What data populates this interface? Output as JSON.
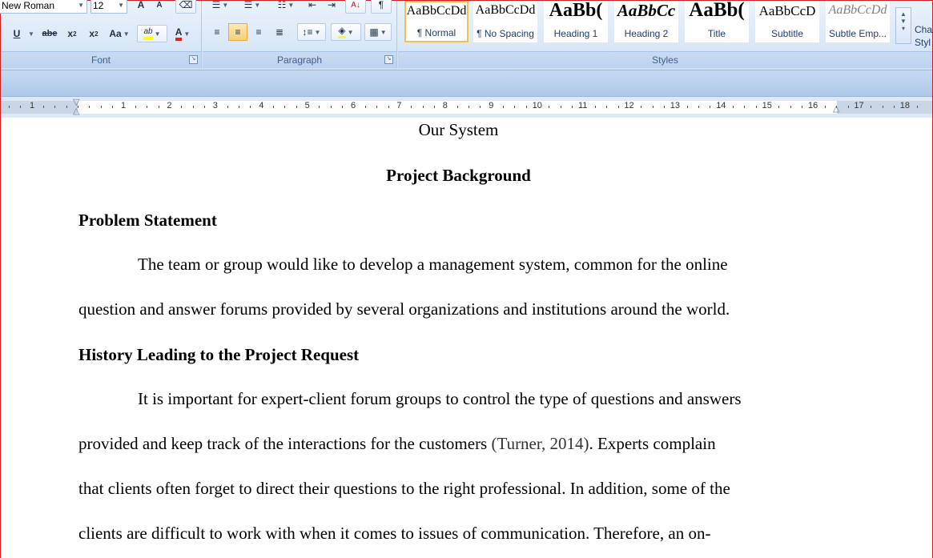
{
  "ribbon": {
    "font": {
      "name_value": "New Roman",
      "size_value": "12",
      "grow_label": "A",
      "shrink_label": "A",
      "underline_label": "U",
      "strike_label": "abe",
      "subscript_label": "x",
      "superscript_label": "x",
      "change_case_label": "Aa",
      "highlight_label": "ab",
      "font_color_label": "A",
      "group_label": "Font"
    },
    "paragraph": {
      "group_label": "Paragraph"
    },
    "styles": {
      "group_label": "Styles",
      "tiles": [
        {
          "sample": "AaBbCcDd",
          "name": "¶ Normal"
        },
        {
          "sample": "AaBbCcDd",
          "name": "¶ No Spacing"
        },
        {
          "sample": "AaBb(",
          "name": "Heading 1"
        },
        {
          "sample": "AaBbCc",
          "name": "Heading 2"
        },
        {
          "sample": "AaBb(",
          "name": "Title"
        },
        {
          "sample": "AaBbCcD",
          "name": "Subtitle"
        },
        {
          "sample": "AaBbCcDd",
          "name": "Subtle Emp..."
        }
      ],
      "change_styles_label": "Cha Styl"
    },
    "colors": {
      "highlight": "#ffff00",
      "font_color": "#e02020",
      "accent": "#f0c050"
    }
  },
  "ruler": {
    "marks": [
      "1",
      "1",
      "2",
      "3",
      "4",
      "5",
      "6",
      "7",
      "8",
      "9",
      "10",
      "11",
      "12",
      "13",
      "14",
      "15",
      "16",
      "17",
      "18"
    ]
  },
  "document": {
    "title": "Our System",
    "section_heading": "Project Background",
    "heading_problem": "Problem Statement",
    "p1_line1": "The team or group would like to develop a management system, common for the online",
    "p1_line2": "question and answer forums provided by several organizations and institutions around the world.",
    "heading_history": "History Leading to the Project Request",
    "p2_line1": "It is important for expert-client forum groups to control the type of questions and answers",
    "p2_line2_a": "provided and keep track of the interactions for the customers ",
    "p2_line2_cite": "(Turner, 2014)",
    "p2_line2_b": ". Experts complain",
    "p2_line3": "that clients often forget to direct their questions to the right professional. In addition, some of the",
    "p2_line4": "clients are difficult to work with when it comes to issues of communication.  Therefore, an on-"
  }
}
